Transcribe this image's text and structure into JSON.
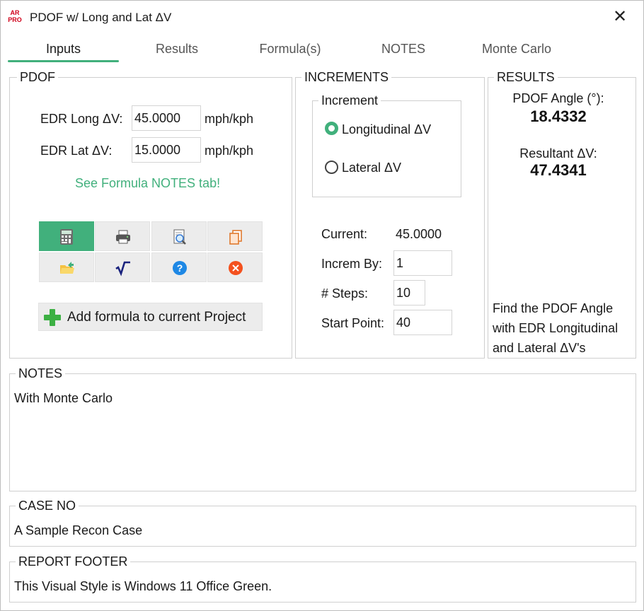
{
  "window": {
    "logo_text": "AR PRO",
    "title": "PDOF w/ Long and Lat ΔV",
    "close_icon": "close-icon"
  },
  "tabs": [
    {
      "label": "Inputs",
      "active": true
    },
    {
      "label": "Results",
      "active": false
    },
    {
      "label": "Formula(s)",
      "active": false
    },
    {
      "label": "NOTES",
      "active": false
    },
    {
      "label": "Monte Carlo",
      "active": false
    }
  ],
  "pdof": {
    "title": "PDOF",
    "long_label": "EDR Long ΔV:",
    "long_value": "45.0000",
    "long_unit": "mph/kph",
    "lat_label": "EDR Lat ΔV:",
    "lat_value": "15.0000",
    "lat_unit": "mph/kph",
    "link_text": "See Formula NOTES tab!",
    "toolbar": [
      {
        "icon": "calculator-icon",
        "active": true
      },
      {
        "icon": "printer-icon",
        "active": false
      },
      {
        "icon": "print-preview-icon",
        "active": false
      },
      {
        "icon": "copy-icon",
        "active": false
      },
      {
        "icon": "open-folder-icon",
        "active": false
      },
      {
        "icon": "square-root-icon",
        "active": false
      },
      {
        "icon": "help-icon",
        "active": false
      },
      {
        "icon": "cancel-icon",
        "active": false
      }
    ],
    "add_button_label": "Add formula to current Project"
  },
  "increments": {
    "title": "INCREMENTS",
    "increment_group_title": "Increment",
    "options": [
      {
        "label": "Longitudinal ΔV",
        "selected": true
      },
      {
        "label": "Lateral ΔV",
        "selected": false
      }
    ],
    "current_label": "Current:",
    "current_value": "45.0000",
    "increm_by_label": "Increm By:",
    "increm_by_value": "1",
    "steps_label": "# Steps:",
    "steps_value": "10",
    "start_point_label": "Start Point:",
    "start_point_value": "40"
  },
  "results": {
    "title": "RESULTS",
    "pdof_angle_label": "PDOF Angle (°):",
    "pdof_angle_value": "18.4332",
    "resultant_label": "Resultant ΔV:",
    "resultant_value": "47.4341",
    "description": "Find the PDOF Angle with EDR Longitudinal and Lateral ΔV's"
  },
  "notes": {
    "title": "NOTES",
    "text": "With Monte Carlo"
  },
  "case_no": {
    "title": "CASE NO",
    "text": "A Sample Recon Case"
  },
  "report_footer": {
    "title": "REPORT FOOTER",
    "text": "This Visual Style is Windows 11 Office Green."
  },
  "colors": {
    "accent": "#41b07c",
    "brand_logo": "#d0021b",
    "help": "#1e88e5",
    "cancel": "#f4511e"
  }
}
